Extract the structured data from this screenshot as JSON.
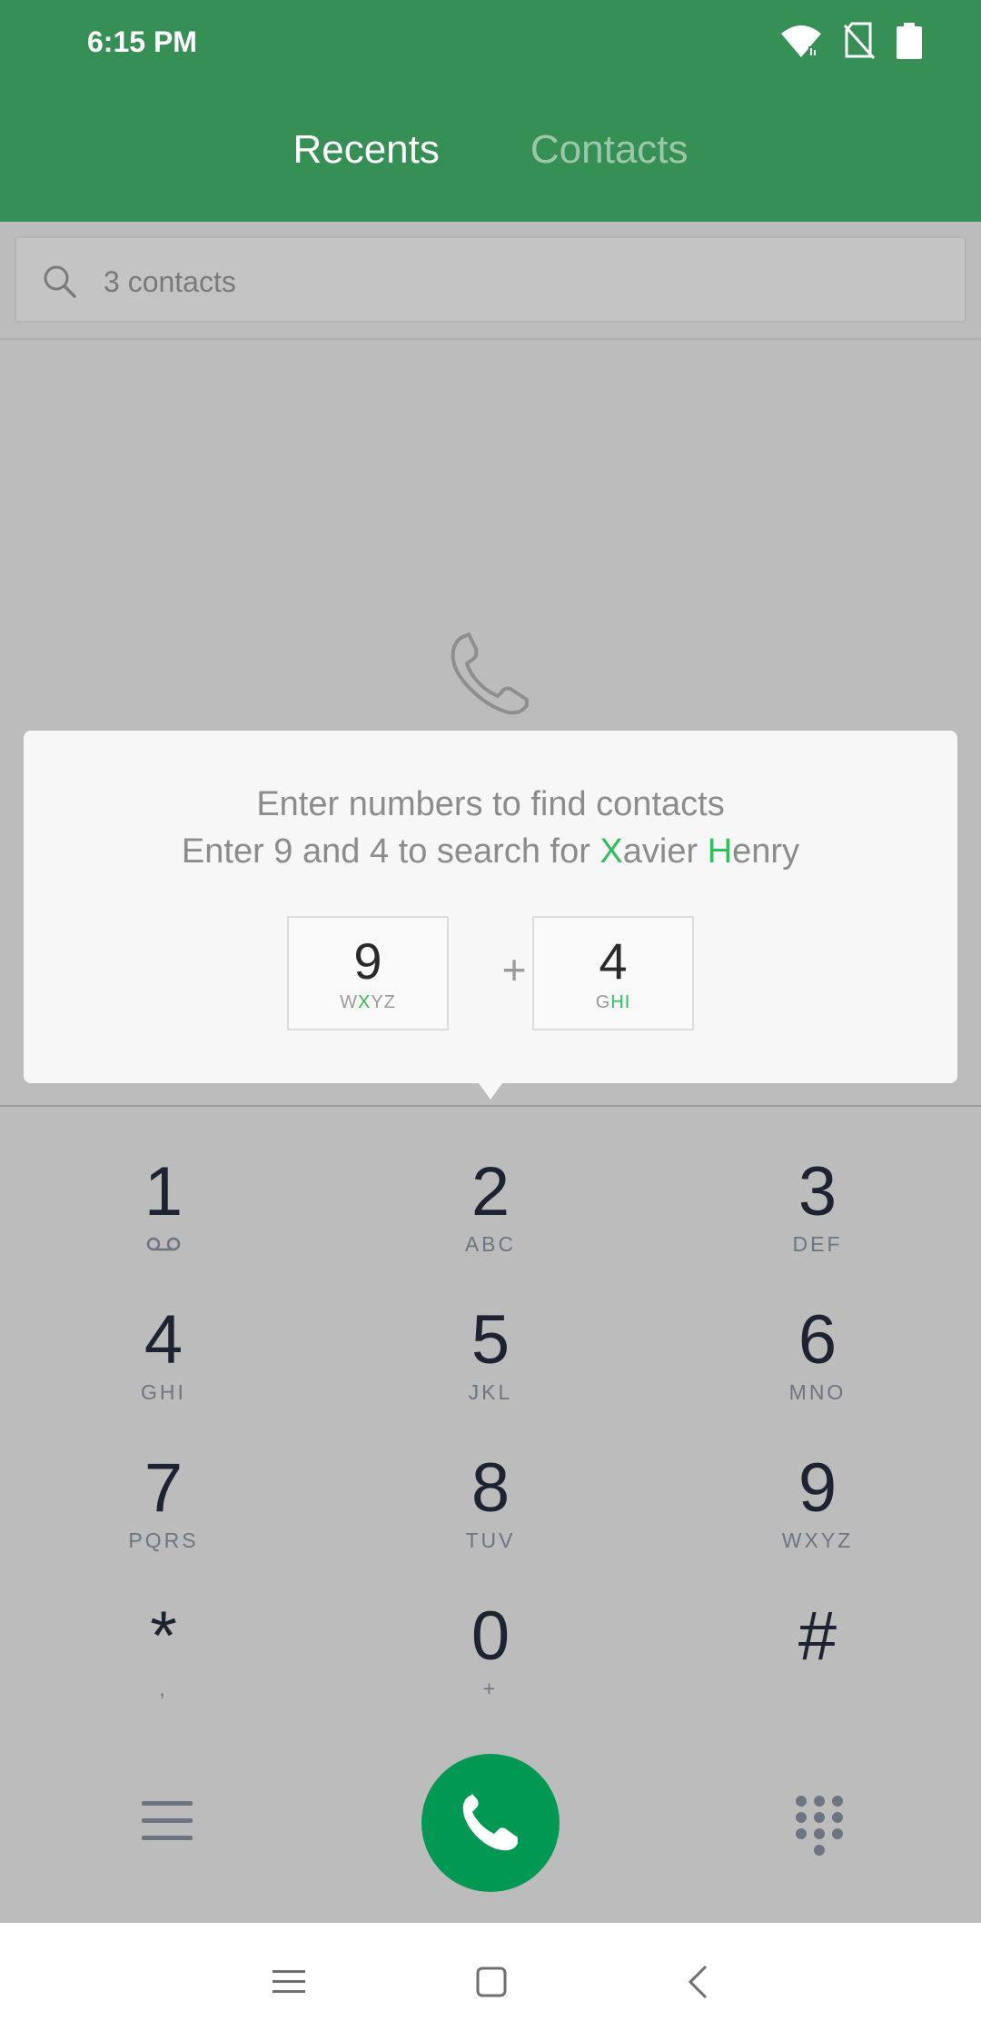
{
  "status": {
    "time": "6:15 PM"
  },
  "tabs": [
    {
      "label": "Recents",
      "active": true
    },
    {
      "label": "Contacts",
      "active": false
    }
  ],
  "search": {
    "placeholder": "3 contacts"
  },
  "tooltip": {
    "line1": "Enter numbers to find contacts",
    "line2_prefix": "Enter 9 and 4 to search for ",
    "name_first_initial": "X",
    "name_first_rest": "avier ",
    "name_last_initial": "H",
    "name_last_rest": "enry",
    "key1": {
      "digit": "9",
      "l1": "W",
      "l2": "X",
      "l3": "YZ"
    },
    "plus": "+",
    "key2": {
      "digit": "4",
      "l1": "G",
      "l2": "H",
      "l3": "I"
    }
  },
  "keypad": [
    {
      "num": "1",
      "letters": ""
    },
    {
      "num": "2",
      "letters": "ABC"
    },
    {
      "num": "3",
      "letters": "DEF"
    },
    {
      "num": "4",
      "letters": "GHI"
    },
    {
      "num": "5",
      "letters": "JKL"
    },
    {
      "num": "6",
      "letters": "MNO"
    },
    {
      "num": "7",
      "letters": "PQRS"
    },
    {
      "num": "8",
      "letters": "TUV"
    },
    {
      "num": "9",
      "letters": "WXYZ"
    },
    {
      "num": "*",
      "letters": ","
    },
    {
      "num": "0",
      "letters": "+"
    },
    {
      "num": "#",
      "letters": ""
    }
  ],
  "colors": {
    "header": "#368f54",
    "highlight": "#2fbf5c",
    "call_button": "#009853"
  },
  "icons": {
    "wifi": "wifi-icon",
    "no_sim": "no-sim-icon",
    "battery": "battery-icon",
    "search": "search-icon",
    "phone": "phone-icon",
    "voicemail": "voicemail-icon",
    "menu": "menu-icon",
    "call": "call-icon",
    "dialpad": "dialpad-icon",
    "nav_menu": "nav-menu-icon",
    "nav_home": "nav-home-icon",
    "nav_back": "nav-back-icon"
  }
}
